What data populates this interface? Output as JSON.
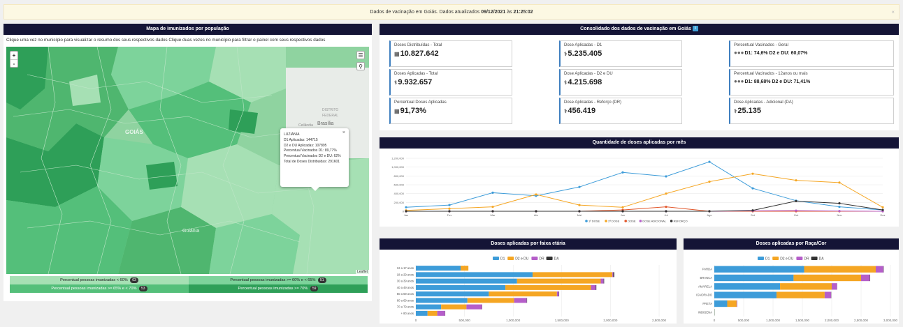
{
  "banner": {
    "prefix": "Dados de vacinação em Goiás. Dados atualizados",
    "date": "09/12/2021",
    "mid": "às",
    "time": "21:25:02",
    "close": "×"
  },
  "map_panel": {
    "title": "Mapa de imunizados por população",
    "instructions": "Clique uma vez no município para visualizar o resumo dos seus respectivos dados Clique duas vezes no município para filtrar o painel com seus respectivos dados",
    "zoom_in": "+",
    "zoom_out": "-",
    "layers_icon": "layers-icon",
    "search_icon": "search-icon",
    "labels": {
      "goias": "GOIÁS",
      "distrito": "DISTRITO",
      "federal": "FEDERAL",
      "brasilia": "Brasília",
      "goiania": "Goiânia",
      "ceilandia": "Ceilândia"
    },
    "popup": {
      "close": "×",
      "name": "LUZIANIA",
      "lines": [
        "D1 Aplicadas: 144715",
        "D2 e DU Aplicadas: 107895",
        "Percentual Vacinados D1: 89,77%",
        "Percentual Vacinados D2 e DU: 62%",
        "Total de Doses Distribuidas: 291601"
      ]
    },
    "attribution": "Leaflet",
    "legend": [
      {
        "label": "Percentual pessoas imunizadas < 60%",
        "count": "63",
        "color": "#a6e0b4"
      },
      {
        "label": "Percentual pessoas imunizadas >= 60% e < 65%",
        "count": "51",
        "color": "#7dd39b"
      },
      {
        "label": "Percentual pessoas imunizadas >= 65% e < 70%",
        "count": "53",
        "color": "#54bf7a"
      },
      {
        "label": "Percentual pessoas imunizadas >= 70%",
        "count": "59",
        "color": "#2e9f58"
      }
    ]
  },
  "consolidado": {
    "title": "Consolidado dos dados de vacinação em Goiás",
    "info_icon": "info-icon",
    "cards": [
      {
        "label": "Doses Distribuídas - Total",
        "value": "10.827.642",
        "icon": "box-icon"
      },
      {
        "label": "Dose Aplicadas - D1",
        "value": "5.235.405",
        "icon": "syringe-icon"
      },
      {
        "label": "Percentual Vacinados - Geral",
        "value": "D1: 74,6% D2 e DU: 60,07%",
        "icon": "people-icon"
      },
      {
        "label": "Doses Aplicadas - Total",
        "value": "9.932.657",
        "icon": "syringe-icon"
      },
      {
        "label": "Dose Aplicadas - D2 e DU",
        "value": "4.215.698",
        "icon": "syringe-icon"
      },
      {
        "label": "Percentual Vacinados - 12anos ou mais",
        "value": "D1: 88,68% D2 e DU: 71,41%",
        "icon": "people-icon"
      },
      {
        "label": "Percentual Doses Aplicadas",
        "value": "91,73%",
        "icon": "box-icon"
      },
      {
        "label": "Dose Aplicadas - Reforço (DR)",
        "value": "456.419",
        "icon": "syringe-icon"
      },
      {
        "label": "Dose Aplicadas - Adicional (DA)",
        "value": "25.135",
        "icon": "syringe-icon"
      }
    ]
  },
  "chart_data": [
    {
      "type": "line",
      "title": "Quantidade de doses aplicadas por mês",
      "categories": [
        "Jan",
        "Fev",
        "Mar",
        "Abr",
        "Mai",
        "Jun",
        "Jul",
        "Ago",
        "Set",
        "Out",
        "Nov",
        "Dez"
      ],
      "ylim": [
        0,
        1200000
      ],
      "yticks": [
        "0",
        "200,000",
        "400,000",
        "600,000",
        "800,000",
        "1,000,000",
        "1,200,000"
      ],
      "series": [
        {
          "name": "1ª DOSE",
          "color": "#3d9cd9",
          "values": [
            90000,
            140000,
            420000,
            350000,
            550000,
            880000,
            790000,
            1120000,
            520000,
            240000,
            100000,
            30000
          ]
        },
        {
          "name": "2ª DOSE",
          "color": "#f5a623",
          "values": [
            20000,
            60000,
            100000,
            380000,
            140000,
            90000,
            400000,
            670000,
            850000,
            700000,
            650000,
            90000
          ]
        },
        {
          "name": "DOSE",
          "color": "#e2572b",
          "values": [
            0,
            0,
            0,
            0,
            0,
            30000,
            100000,
            0,
            0,
            0,
            0,
            0
          ]
        },
        {
          "name": "DOSE ADICIONAL",
          "color": "#b55ec9",
          "values": [
            0,
            0,
            0,
            0,
            0,
            0,
            0,
            0,
            10000,
            15000,
            5000,
            0
          ]
        },
        {
          "name": "REFORÇO",
          "color": "#333333",
          "values": [
            0,
            0,
            0,
            0,
            0,
            0,
            0,
            0,
            20000,
            230000,
            180000,
            30000
          ]
        }
      ]
    },
    {
      "type": "bar",
      "orientation": "horizontal",
      "stacked": true,
      "title": "Doses aplicadas por faixa etária",
      "categories": [
        "12 a 17 anos",
        "18 a 29 anos",
        "30 a 39 anos",
        "40 a 49 anos",
        "50 a 59 anos",
        "60 a 69 anos",
        "70 a 79 anos",
        "+ 80 anos"
      ],
      "xlim": [
        0,
        2500000
      ],
      "xticks": [
        "0",
        "500,000",
        "1,000,000",
        "1,500,000",
        "2,000,000",
        "2,500,000"
      ],
      "series": [
        {
          "name": "D1",
          "color": "#3d9cd9",
          "values": [
            460000,
            1200000,
            1040000,
            920000,
            750000,
            530000,
            260000,
            120000
          ]
        },
        {
          "name": "D2 e DU",
          "color": "#f5a623",
          "values": [
            80000,
            820000,
            860000,
            880000,
            700000,
            480000,
            260000,
            100000
          ]
        },
        {
          "name": "DR",
          "color": "#b55ec9",
          "values": [
            0,
            10000,
            30000,
            50000,
            20000,
            130000,
            160000,
            80000
          ]
        },
        {
          "name": "DA",
          "color": "#333333",
          "values": [
            0,
            10000,
            5000,
            5000,
            3000,
            3000,
            2000,
            2000
          ]
        }
      ]
    },
    {
      "type": "bar",
      "orientation": "horizontal",
      "stacked": true,
      "title": "Doses aplicadas por Raça/Cor",
      "categories": [
        "PARDA",
        "BRANCA",
        "AMARELA",
        "IGNORADO",
        "PRETA",
        "INDIGENA"
      ],
      "xlim": [
        0,
        3000000
      ],
      "xticks": [
        "0",
        "500,000",
        "1,000,000",
        "1,500,000",
        "2,000,000",
        "2,500,000",
        "3,000,000"
      ],
      "series": [
        {
          "name": "D1",
          "color": "#3d9cd9",
          "values": [
            1530000,
            1350000,
            1120000,
            1060000,
            220000,
            5000
          ]
        },
        {
          "name": "D2 e DU",
          "color": "#f5a623",
          "values": [
            1220000,
            1150000,
            880000,
            820000,
            160000,
            3000
          ]
        },
        {
          "name": "DR",
          "color": "#b55ec9",
          "values": [
            130000,
            150000,
            90000,
            110000,
            10000,
            0
          ]
        },
        {
          "name": "DA",
          "color": "#333333",
          "values": [
            5000,
            5000,
            2000,
            3000,
            1000,
            0
          ]
        }
      ]
    }
  ]
}
